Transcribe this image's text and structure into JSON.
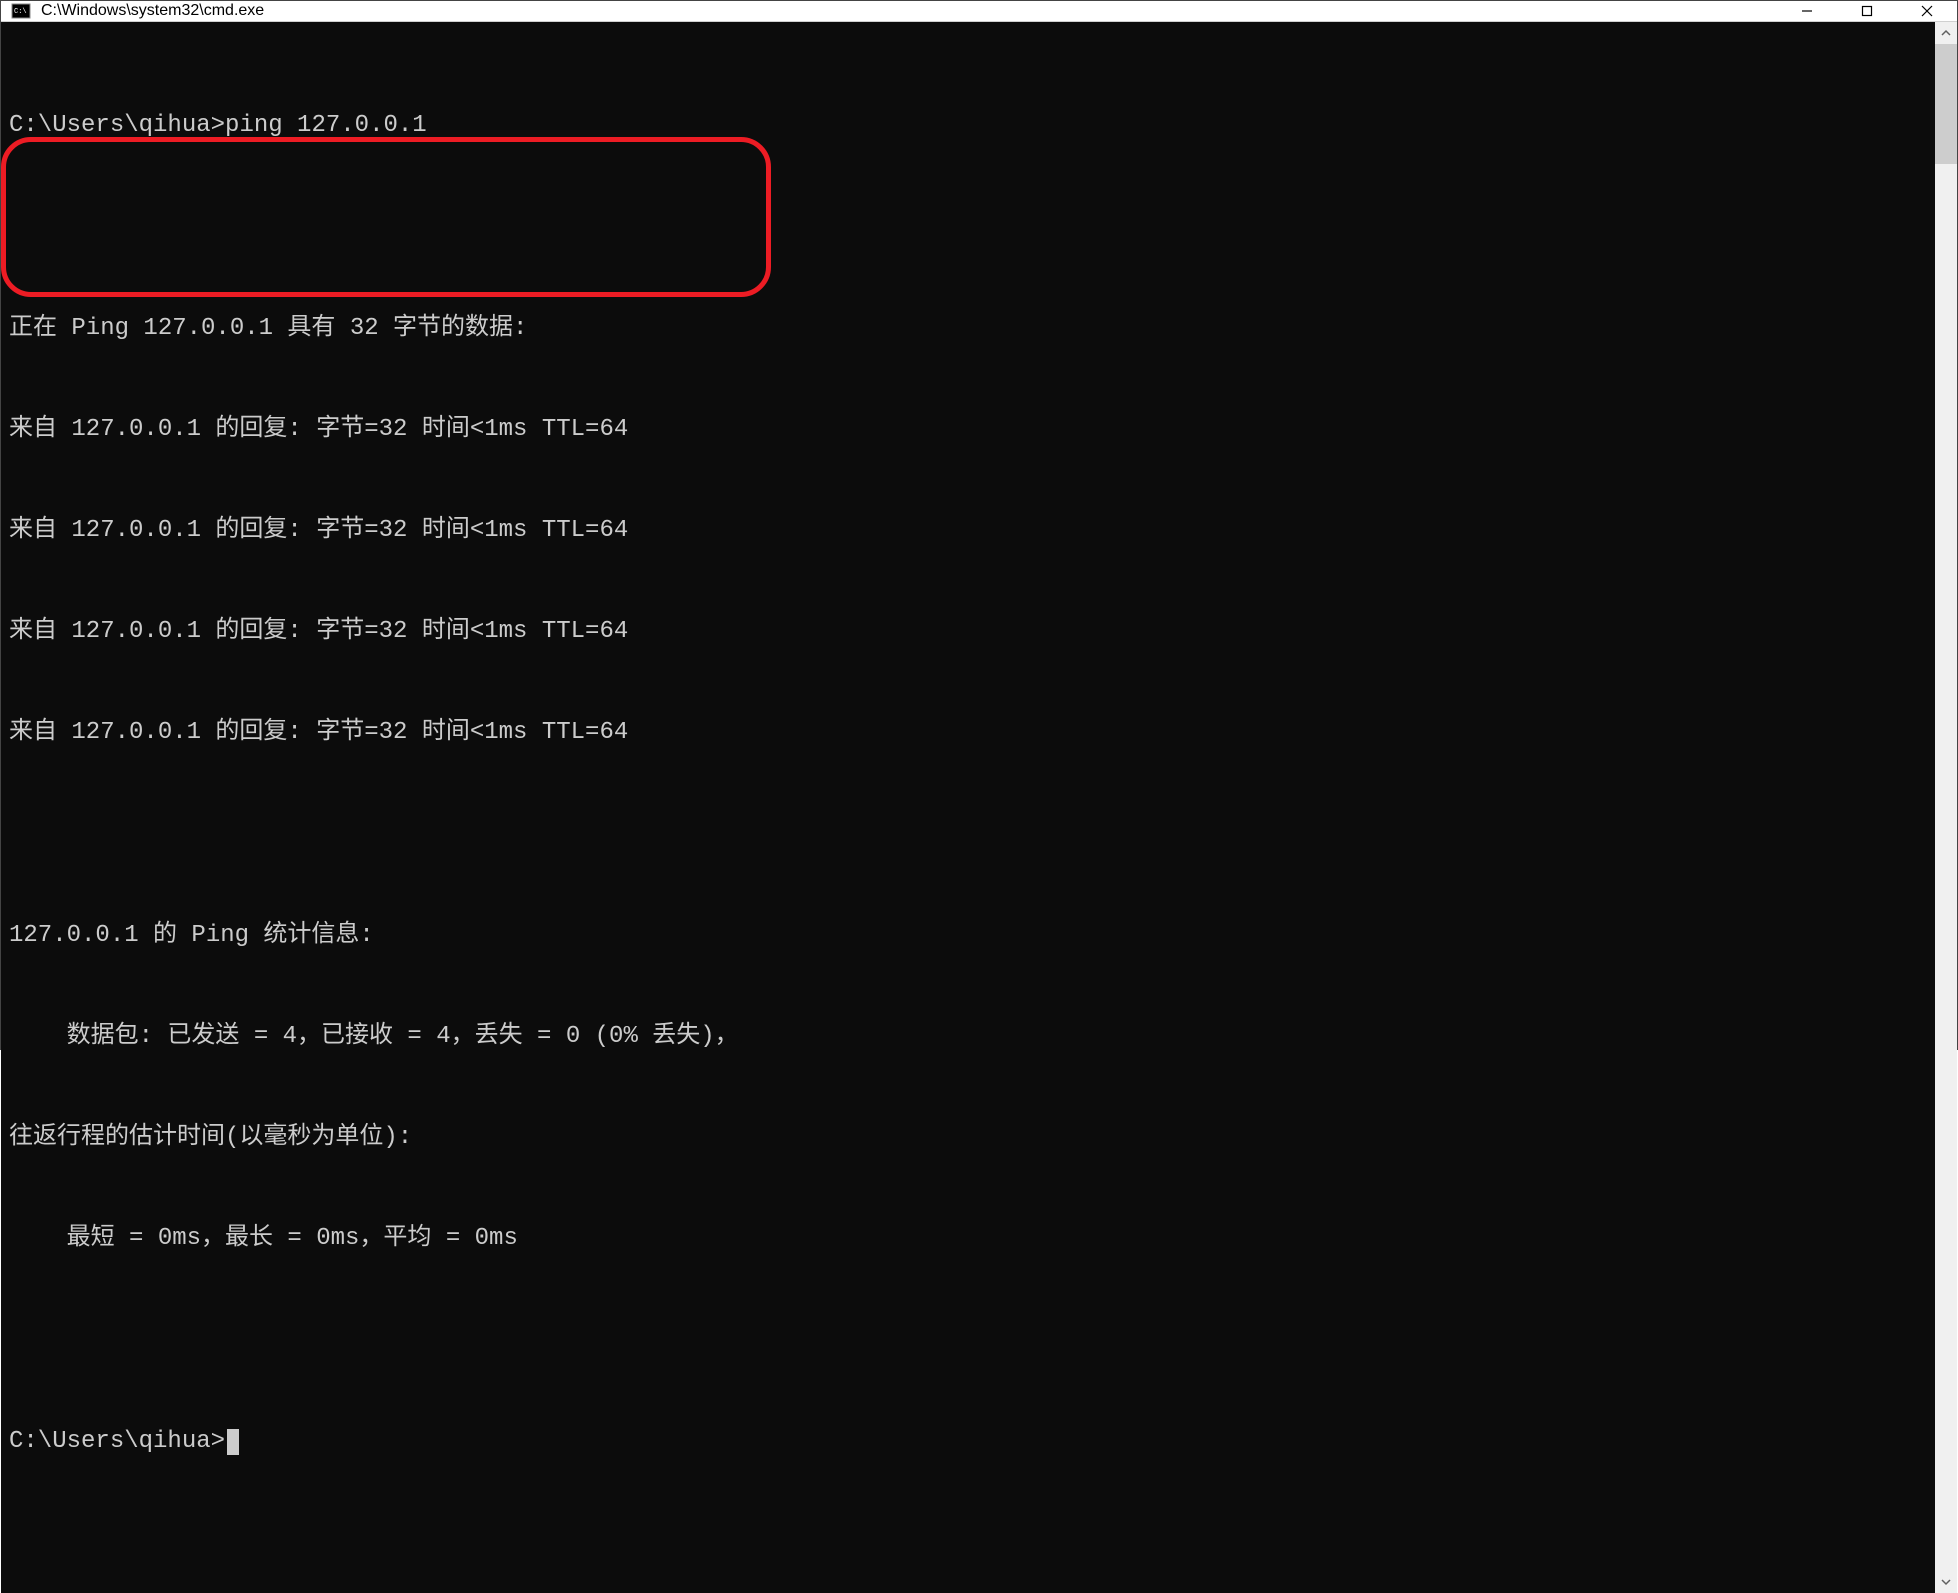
{
  "window": {
    "title": "C:\\Windows\\system32\\cmd.exe"
  },
  "terminal": {
    "prompt1_path": "C:\\Users\\qihua>",
    "prompt1_command": "ping 127.0.0.1",
    "blank1": "",
    "ping_header": "正在 Ping 127.0.0.1 具有 32 字节的数据:",
    "reply1": "来自 127.0.0.1 的回复: 字节=32 时间<1ms TTL=64",
    "reply2": "来自 127.0.0.1 的回复: 字节=32 时间<1ms TTL=64",
    "reply3": "来自 127.0.0.1 的回复: 字节=32 时间<1ms TTL=64",
    "reply4": "来自 127.0.0.1 的回复: 字节=32 时间<1ms TTL=64",
    "blank2": "",
    "stats_header": "127.0.0.1 的 Ping 统计信息:",
    "stats_packets": "    数据包: 已发送 = 4，已接收 = 4，丢失 = 0 (0% 丢失)，",
    "stats_rtt_header": "往返行程的估计时间(以毫秒为单位):",
    "stats_rtt_values": "    最短 = 0ms，最长 = 0ms，平均 = 0ms",
    "blank3": "",
    "prompt2_path": "C:\\Users\\qihua>"
  },
  "annotation": {
    "color": "#ed1c24"
  }
}
